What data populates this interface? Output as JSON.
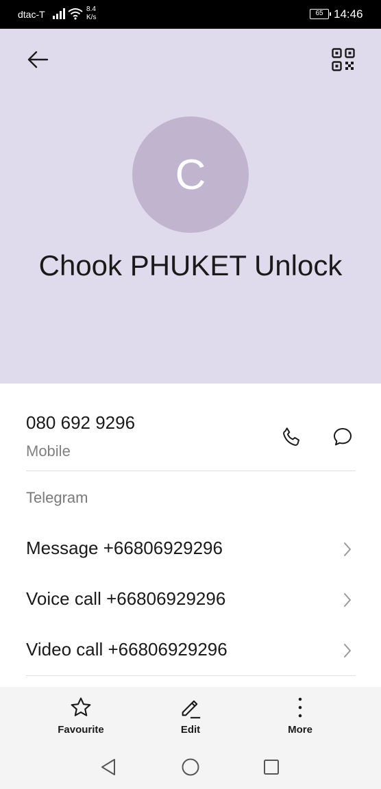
{
  "status_bar": {
    "carrier": "dtac-T",
    "speed_value": "8.4",
    "speed_unit": "K/s",
    "battery": "65",
    "time": "14:46"
  },
  "header": {
    "avatar_initial": "C",
    "name": "Chook PHUKET Unlock"
  },
  "phone": {
    "number": "080 692 9296",
    "type": "Mobile"
  },
  "telegram": {
    "title": "Telegram",
    "items": [
      {
        "label": "Message +66806929296"
      },
      {
        "label": "Voice call +66806929296"
      },
      {
        "label": "Video call +66806929296"
      }
    ]
  },
  "actions": {
    "favourite": "Favourite",
    "edit": "Edit",
    "more": "More"
  },
  "colors": {
    "header_bg": "#e0dbec",
    "avatar_bg": "#c0b4cf"
  }
}
